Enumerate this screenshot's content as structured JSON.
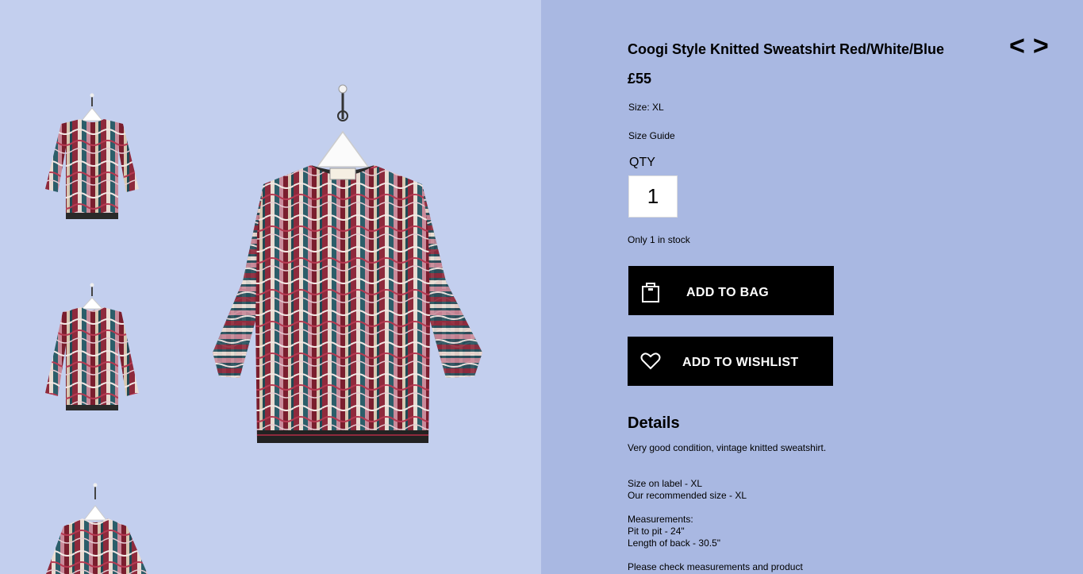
{
  "colors": {
    "left_background": "#c3cfee",
    "right_background": "#a9b8e2",
    "button_background": "#000000",
    "button_text": "#ffffff"
  },
  "gallery": {
    "thumbnails": [
      {
        "name": "sweatshirt-thumbnail-1"
      },
      {
        "name": "sweatshirt-thumbnail-2"
      },
      {
        "name": "sweatshirt-thumbnail-3"
      }
    ],
    "main_image": "sweatshirt-main-image"
  },
  "product": {
    "title": "Coogi Style Knitted Sweatshirt Red/White/Blue",
    "price": "£55",
    "size": "Size: XL",
    "size_guide": "Size Guide",
    "qty_label": "QTY",
    "qty_value": "1",
    "stock": "Only 1 in stock"
  },
  "nav": {
    "prev": "<",
    "next": ">"
  },
  "buttons": {
    "add_to_bag": "ADD TO BAG",
    "add_to_bag_icon": "shopping-bag-icon",
    "add_to_wishlist": "ADD TO WISHLIST",
    "add_to_wishlist_icon": "heart-icon"
  },
  "details": {
    "heading": "Details",
    "description": "Very good condition, vintage knitted sweatshirt.",
    "size_on_label": "Size on label - XL",
    "recommended_size": "Our recommended size - XL",
    "measurements_heading": "Measurements:",
    "pit_to_pit": "Pit to pit - 24\"",
    "length_of_back": "Length of back - 30.5\"",
    "note": "Please check measurements and product"
  }
}
